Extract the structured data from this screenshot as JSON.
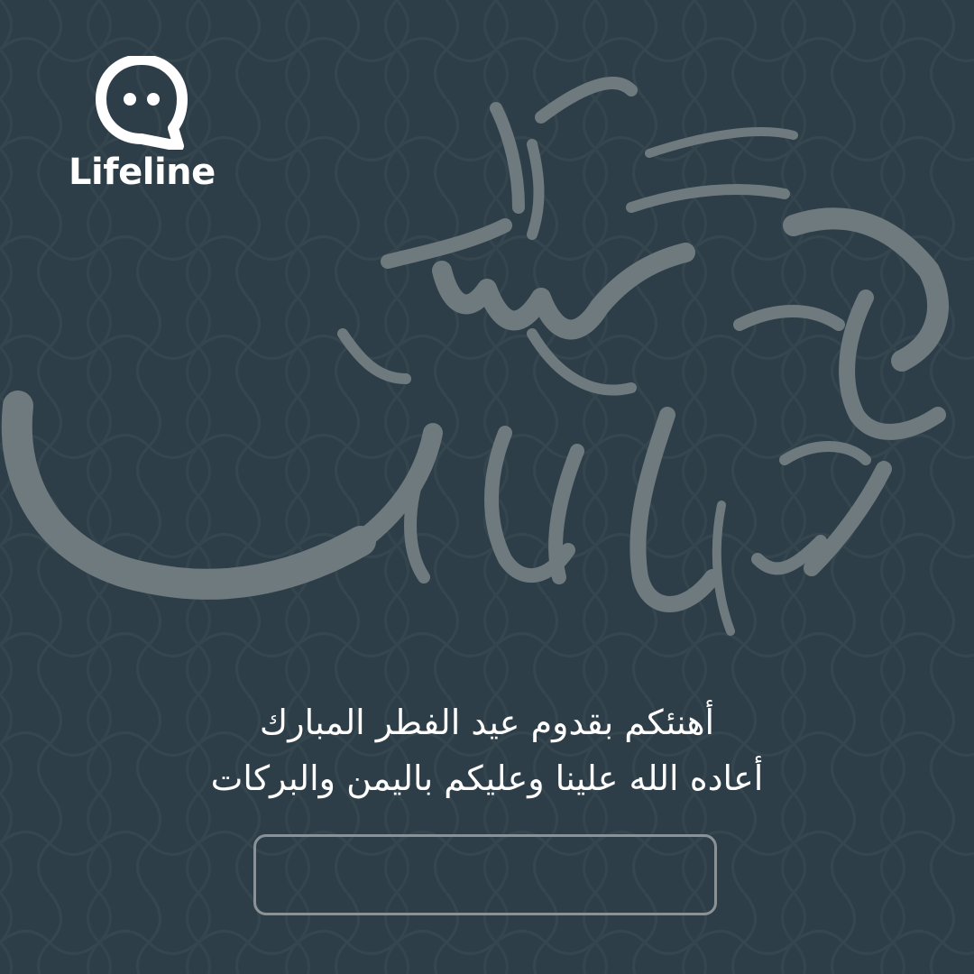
{
  "brand": {
    "name": "Lifeline",
    "icon": "chat-bubble-icon"
  },
  "calligraphy": {
    "text": "عيد سعيد",
    "color": "#6f7a7e"
  },
  "greeting": {
    "line1": "أهنئكم بقدوم عيد الفطر المبارك",
    "line2": "أعاده الله علينا وعليكم باليمن والبركات"
  },
  "colors": {
    "background": "#2e3e48",
    "text": "#ffffff",
    "box_border": "#8a9296"
  }
}
